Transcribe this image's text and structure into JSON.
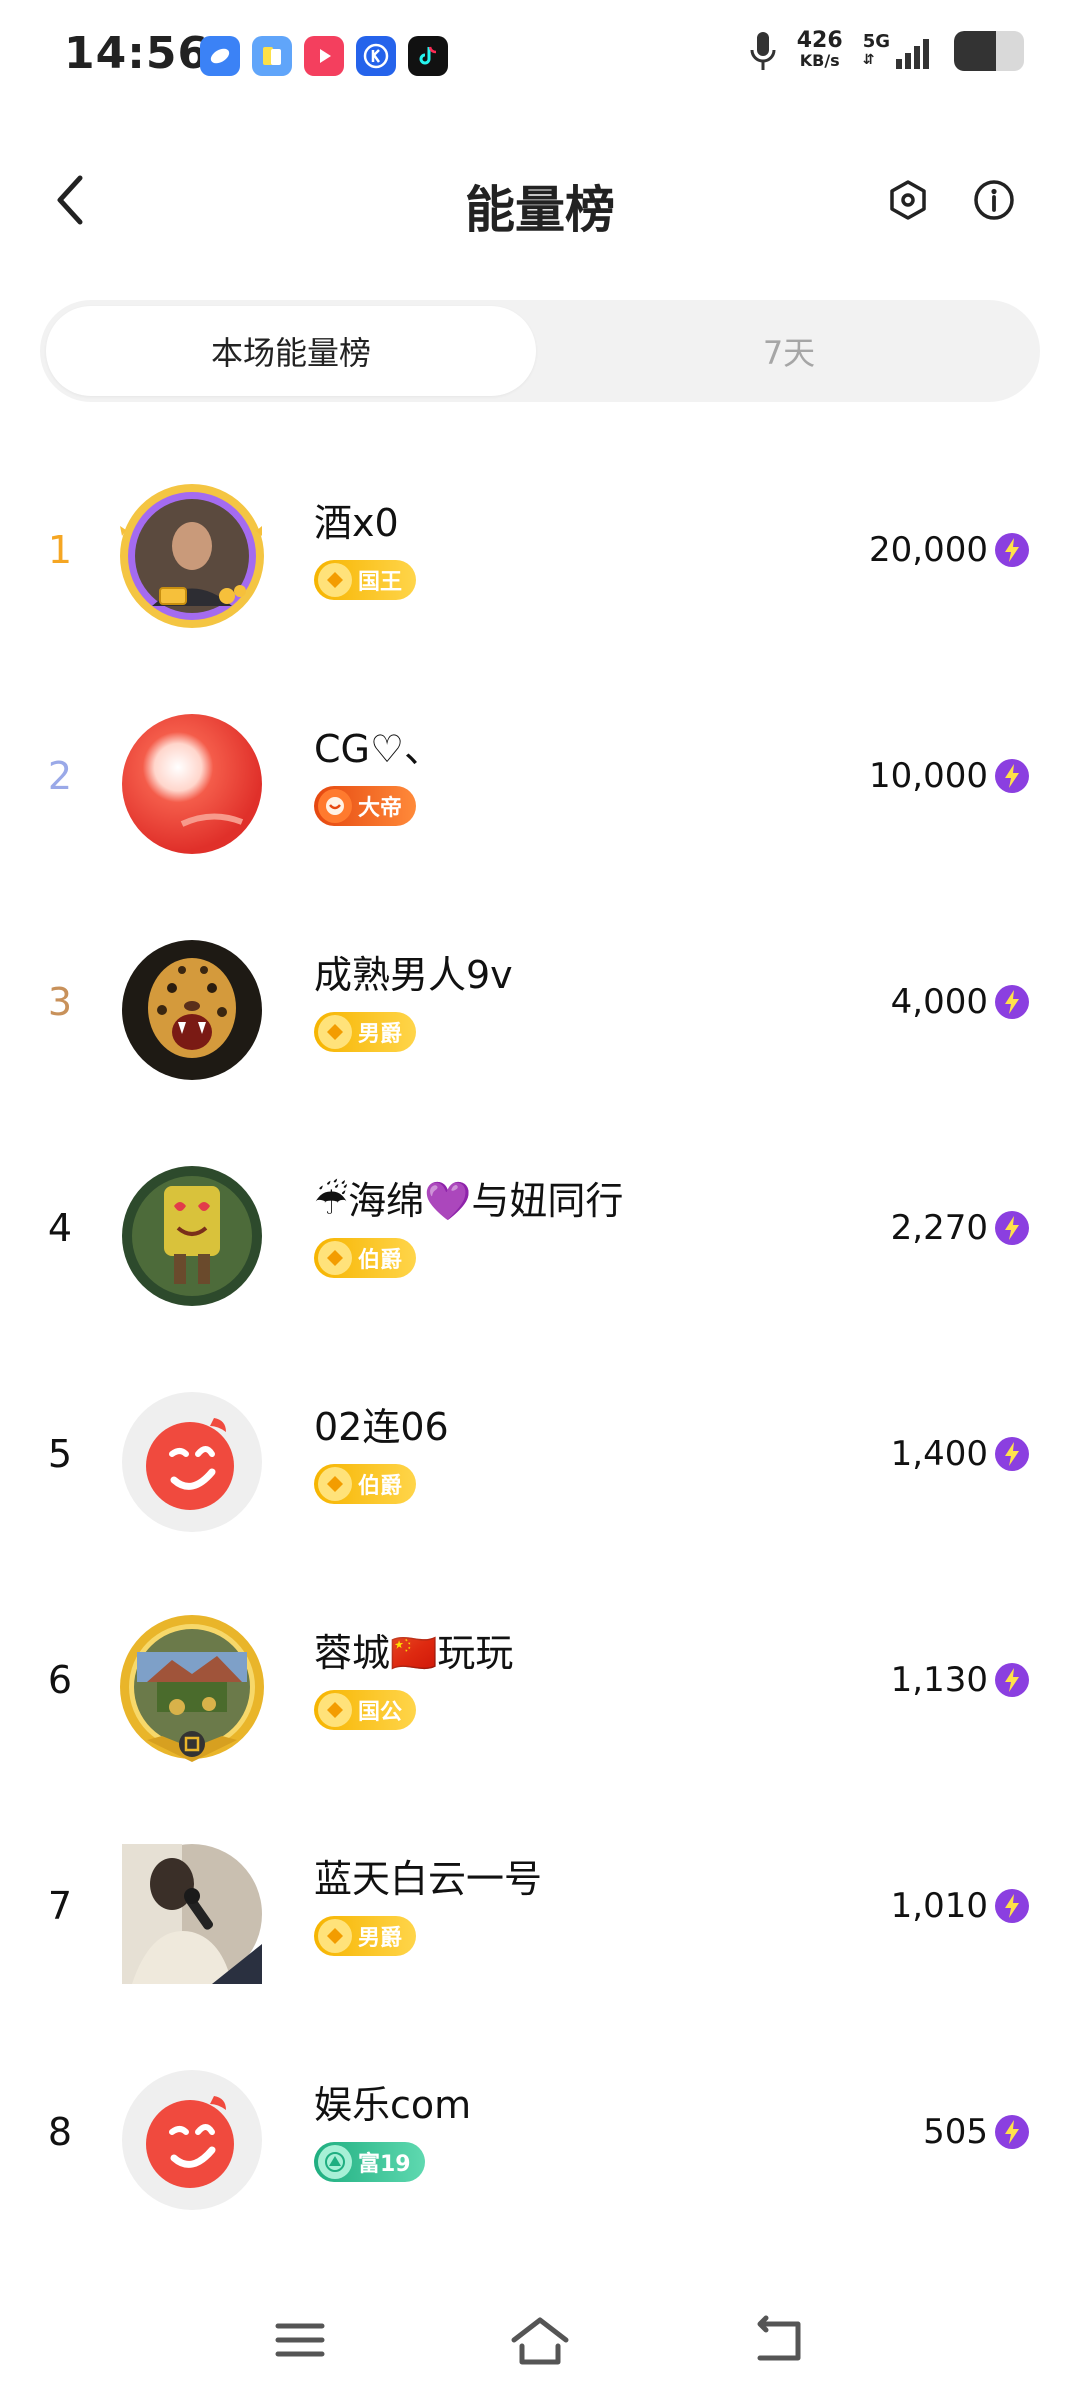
{
  "status_bar": {
    "time": "14:56",
    "apps": [
      {
        "icon": "app-blue-icon",
        "color": "#3b82f6"
      },
      {
        "icon": "app-files-icon",
        "color": "#60a5fa"
      },
      {
        "icon": "app-video-icon",
        "color": "#f43f5e"
      },
      {
        "icon": "app-k-icon",
        "color": "#2563eb"
      },
      {
        "icon": "tiktok-icon",
        "color": "#111111"
      }
    ],
    "speed_value": "426",
    "speed_unit": "KB/s",
    "network": "5G",
    "battery_level": 0.6
  },
  "header": {
    "title": "能量榜",
    "back_icon": "chevron-left-icon",
    "settings_icon": "hexagon-settings-icon",
    "info_icon": "info-icon"
  },
  "tabs": [
    {
      "label": "本场能量榜",
      "active": true
    },
    {
      "label": "7天",
      "active": false
    }
  ],
  "rankings": [
    {
      "rank": "1",
      "name": "酒x0",
      "badge": "国王",
      "badge_type": "gold",
      "score": "20,000",
      "rank_color": "#f5a623"
    },
    {
      "rank": "2",
      "name": "CG♡、",
      "badge": "大帝",
      "badge_type": "orange",
      "score": "10,000",
      "rank_color": "#9aa9e8"
    },
    {
      "rank": "3",
      "name": "成熟男人9v",
      "badge": "男爵",
      "badge_type": "gold",
      "score": "4,000",
      "rank_color": "#c8915a"
    },
    {
      "rank": "4",
      "name": "☔海绵💜与妞同行",
      "badge": "伯爵",
      "badge_type": "gold",
      "score": "2,270",
      "rank_color": "#222222"
    },
    {
      "rank": "5",
      "name": "02连06",
      "badge": "伯爵",
      "badge_type": "gold",
      "score": "1,400",
      "rank_color": "#222222"
    },
    {
      "rank": "6",
      "name": "蓉城🇨🇳玩玩",
      "badge": "国公",
      "badge_type": "gold",
      "score": "1,130",
      "rank_color": "#222222"
    },
    {
      "rank": "7",
      "name": "蓝天白云一号",
      "badge": "男爵",
      "badge_type": "gold",
      "score": "1,010",
      "rank_color": "#222222"
    },
    {
      "rank": "8",
      "name": "娱乐com",
      "badge": "富19",
      "badge_type": "green",
      "score": "505",
      "rank_color": "#222222"
    }
  ],
  "navbar": {
    "menu_icon": "menu-icon",
    "home_icon": "home-icon",
    "back_icon": "back-arrow-icon"
  },
  "colors": {
    "energy": "#8b3fe0",
    "gold_badge": "#f5b800",
    "orange_badge": "#f26a1b",
    "green_badge": "#2dbf8f"
  }
}
